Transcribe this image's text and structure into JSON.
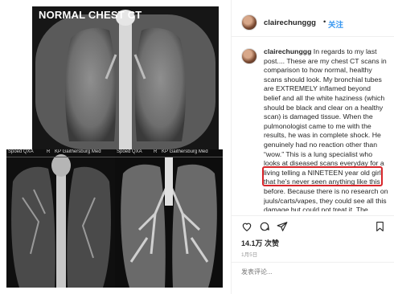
{
  "media": {
    "normal_label": "NORMAL CHEST CT",
    "left_scan_meta_a": "Spoed QXA",
    "left_scan_meta_b": "KP Gaithersburg Med",
    "left_scan_meta_mid": "R",
    "right_scan_meta_a": "Spoed QXA",
    "right_scan_meta_b": "KP Gaithersburg Med",
    "right_scan_meta_mid": "R"
  },
  "header": {
    "username": "clairechunggg",
    "dot": "•",
    "follow_label": "关注"
  },
  "caption": {
    "username": "clairechunggg",
    "text_before": " In regards to my last post.... These are my chest CT scans in comparison to how normal, healthy scans should look. My bronchial tubes are EXTREMELY inflamed beyond belief and all the white haziness (which should be black and clear on a healthy scan) is damaged tissue. When the pulmonologist came to me with the results, he was in complete shock. He genuinely had no reaction other than “wow.” This is a lung specialist who looks at diseased scans everyday for a living telling a NINETEEN year old girl that he’s never seen anything like this before. Because there is no research on juuls/carts/vapes, they could see all this damage but could not treat it. The doctors don’t know whether this will"
  },
  "stats": {
    "likes": "14.1万 次赞",
    "date": "1月5日"
  },
  "comment": {
    "placeholder": "发表评论..."
  },
  "icons": {
    "like": "heart-icon",
    "comment": "comment-icon",
    "share": "share-icon",
    "save": "bookmark-icon"
  }
}
